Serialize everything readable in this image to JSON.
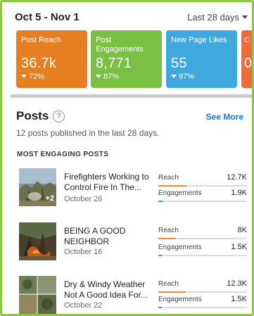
{
  "header": {
    "date_range": "Oct 5 - Nov 1",
    "period": "Last 28 days"
  },
  "tiles": [
    {
      "label": "Post Reach",
      "value": "36.7k",
      "change": "72%",
      "color": "#e67e22"
    },
    {
      "label": "Post Engagements",
      "value": "8,771",
      "change": "87%",
      "color": "#7ac043"
    },
    {
      "label": "New Page Likes",
      "value": "55",
      "change": "97%",
      "color": "#3fa9de"
    },
    {
      "label": "C",
      "value": "0",
      "change": "",
      "color": "#f06a3a"
    }
  ],
  "posts_section": {
    "title": "Posts",
    "help_icon": "?",
    "see_more": "See More",
    "subtitle": "12 posts published in the last 28 days.",
    "list_title": "MOST ENGAGING POSTS"
  },
  "posts": [
    {
      "title": "Firefighters Working to Control Fire In The...",
      "date": "October 26",
      "thumb_badge": "+2",
      "reach_label": "Reach",
      "reach": "12.7K",
      "reach_fraction": 0.32,
      "eng_label": "Engagements",
      "engagements": "1.9K",
      "eng_fraction": 0.05
    },
    {
      "title": "BEING A GOOD NEIGHBOR",
      "date": "October 16",
      "thumb_badge": "",
      "reach_label": "Reach",
      "reach": "8K",
      "reach_fraction": 0.2,
      "eng_label": "Engagements",
      "engagements": "1.5K",
      "eng_fraction": 0.04
    },
    {
      "title": "Dry & Windy Weather Not A Good Idea For...",
      "date": "October 22",
      "thumb_badge": "",
      "reach_label": "Reach",
      "reach": "12.3K",
      "reach_fraction": 0.31,
      "eng_label": "Engagements",
      "engagements": "1.5K",
      "eng_fraction": 0.04
    }
  ]
}
